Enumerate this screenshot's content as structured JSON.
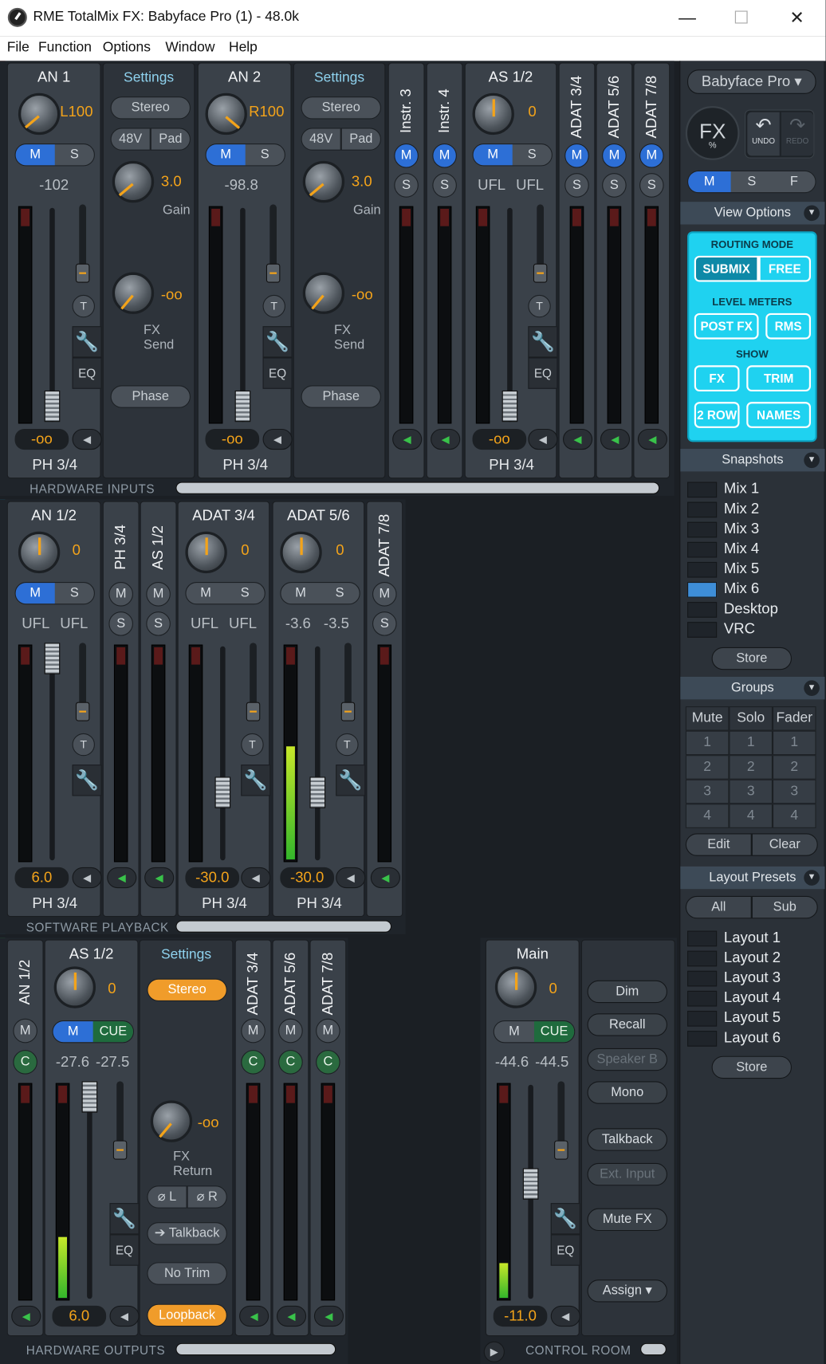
{
  "window": {
    "title": "RME TotalMix FX: Babyface Pro (1) - 48.0k",
    "minimize": "—",
    "maximize": "☐",
    "close": "✕"
  },
  "menu": [
    "File",
    "Function",
    "Options",
    "Window",
    "Help"
  ],
  "common": {
    "settings": "Settings",
    "stereo": "Stereo",
    "v48": "48V",
    "pad": "Pad",
    "gain": "Gain",
    "fxsend": "FX Send",
    "phase": "Phase",
    "minf": "-oo",
    "m": "M",
    "s": "S",
    "c": "C",
    "cue": "CUE",
    "eq": "EQ",
    "t": "T",
    "zero": "0",
    "ph34": "PH 3/4"
  },
  "inputs": {
    "section": "HARDWARE INPUTS",
    "an1": {
      "name": "AN 1",
      "pan": "L100",
      "level": "-102",
      "gain": "3.0",
      "fx": "-oo",
      "out": "-oo"
    },
    "an2": {
      "name": "AN 2",
      "pan": "R100",
      "level": "-98.8",
      "gain": "3.0",
      "fx": "-oo",
      "out": "-oo"
    },
    "instr3": "Instr. 3",
    "instr4": "Instr. 4",
    "as12": {
      "name": "AS 1/2",
      "pan": "0",
      "levL": "UFL",
      "levR": "UFL",
      "out": "-oo"
    },
    "adat34": "ADAT 3/4",
    "adat56": "ADAT 5/6",
    "adat78": "ADAT 7/8"
  },
  "playback": {
    "section": "SOFTWARE PLAYBACK",
    "an12": {
      "name": "AN 1/2",
      "pan": "0",
      "levL": "UFL",
      "levR": "UFL",
      "out": "6.0"
    },
    "ph34": "PH 3/4",
    "as12": "AS 1/2",
    "adat34": {
      "name": "ADAT 3/4",
      "pan": "0",
      "levL": "UFL",
      "levR": "UFL",
      "out": "-30.0"
    },
    "adat56": {
      "name": "ADAT 5/6",
      "pan": "0",
      "levL": "-3.6",
      "levR": "-3.5",
      "out": "-30.0"
    },
    "adat78": "ADAT 7/8"
  },
  "outputs": {
    "section": "HARDWARE OUTPUTS",
    "an12": "AN 1/2",
    "as12": {
      "name": "AS 1/2",
      "pan": "0",
      "levL": "-27.6",
      "levR": "-27.5",
      "out": "6.0"
    },
    "settings": {
      "stereo": "Stereo",
      "fxreturn": "FX Return",
      "fxval": "-oo",
      "phaseL": "⌀ L",
      "phaseR": "⌀ R",
      "talkback": "➔ Talkback",
      "notrim": "No Trim",
      "loopback": "Loopback"
    },
    "adat34": "ADAT 3/4",
    "adat56": "ADAT 5/6",
    "adat78": "ADAT 7/8"
  },
  "control_room": {
    "section": "CONTROL ROOM",
    "main": {
      "name": "Main",
      "pan": "0",
      "levL": "-44.6",
      "levR": "-44.5",
      "out": "-11.0"
    },
    "buttons": {
      "dim": "Dim",
      "recall": "Recall",
      "speakerb": "Speaker B",
      "mono": "Mono",
      "talkback": "Talkback",
      "extinput": "Ext. Input",
      "mutefx": "Mute FX",
      "assign": "Assign ▾"
    }
  },
  "sidebar": {
    "device": "Babyface Pro",
    "fx": "FX",
    "fx_pct": "%",
    "undo": "UNDO",
    "redo": "REDO",
    "msf": [
      "M",
      "S",
      "F"
    ],
    "view_options": "View Options",
    "routing_mode": "ROUTING MODE",
    "submix": "SUBMIX",
    "free": "FREE",
    "level_meters": "LEVEL METERS",
    "postfx": "POST FX",
    "rms": "RMS",
    "show": "SHOW",
    "fxbtn": "FX",
    "trim": "TRIM",
    "row2": "2 ROW",
    "names": "NAMES",
    "snapshots": "Snapshots",
    "snapshot_items": [
      "Mix 1",
      "Mix 2",
      "Mix 3",
      "Mix 4",
      "Mix 5",
      "Mix 6",
      "Desktop",
      "VRC"
    ],
    "store": "Store",
    "groups": "Groups",
    "group_cols": [
      "Mute",
      "Solo",
      "Fader"
    ],
    "group_rows": [
      "1",
      "2",
      "3",
      "4"
    ],
    "edit": "Edit",
    "clear": "Clear",
    "layout_presets": "Layout Presets",
    "all": "All",
    "sub": "Sub",
    "layouts": [
      "Layout 1",
      "Layout 2",
      "Layout 3",
      "Layout 4",
      "Layout 5",
      "Layout 6"
    ]
  },
  "colors": {
    "accent_orange": "#f3a31a",
    "mute_blue": "#2d6fd6",
    "cue_green": "#1f6b3d",
    "view_cyan": "#1fd2f0",
    "stripe_red": "#c0392b",
    "stripe_cyan": "#1a9ec0",
    "stripe_green": "#2e9e47"
  }
}
